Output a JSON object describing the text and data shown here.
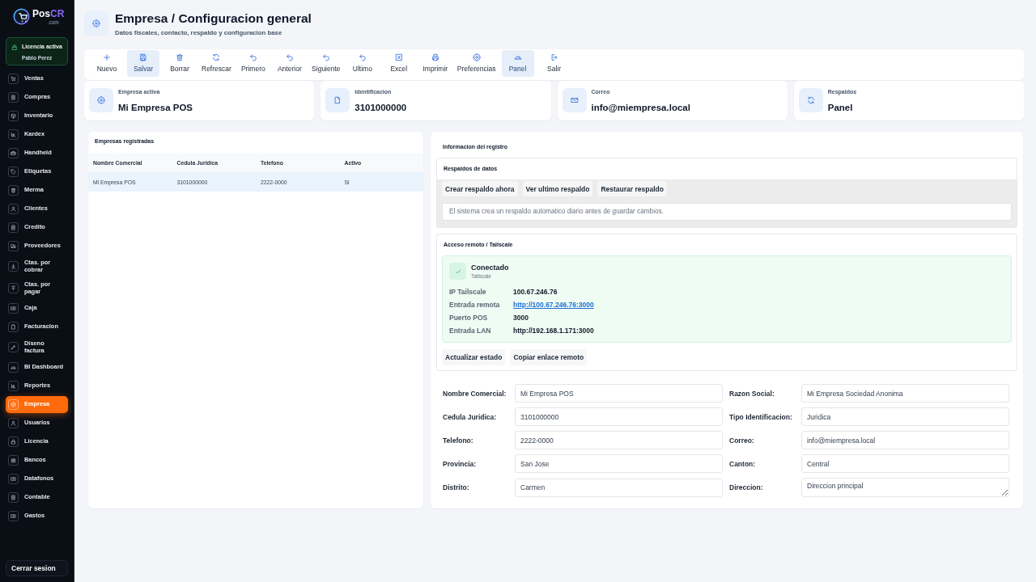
{
  "sidebar": {
    "logo": {
      "name": "Pos",
      "accent": "CR",
      "domain": ".com"
    },
    "license": {
      "title": "Licencia activa",
      "user": "Pablo Perez"
    },
    "items": [
      {
        "label": "Ventas",
        "selected": false
      },
      {
        "label": "Compras",
        "selected": false
      },
      {
        "label": "Inventario",
        "selected": false
      },
      {
        "label": "Kardex",
        "selected": false
      },
      {
        "label": "Handheld",
        "selected": false
      },
      {
        "label": "Etiquetas",
        "selected": false
      },
      {
        "label": "Merma",
        "selected": false
      },
      {
        "label": "Clientes",
        "selected": false
      },
      {
        "label": "Credito",
        "selected": false
      },
      {
        "label": "Proveedores",
        "selected": false
      },
      {
        "label": "Ctas. por cobrar",
        "selected": false
      },
      {
        "label": "Ctas. por pagar",
        "selected": false
      },
      {
        "label": "Caja",
        "selected": false
      },
      {
        "label": "Facturacion",
        "selected": false
      },
      {
        "label": "Diseno factura",
        "selected": false
      },
      {
        "label": "BI Dashboard",
        "selected": false
      },
      {
        "label": "Reportes",
        "selected": false
      },
      {
        "label": "Empresa",
        "selected": true
      },
      {
        "label": "Usuarios",
        "selected": false
      },
      {
        "label": "Licencia",
        "selected": false
      },
      {
        "label": "Bancos",
        "selected": false
      },
      {
        "label": "Datafonos",
        "selected": false
      },
      {
        "label": "Contable",
        "selected": false
      },
      {
        "label": "Gastos",
        "selected": false
      }
    ],
    "logout": "Cerrar sesion"
  },
  "header": {
    "title": "Empresa / Configuracion general",
    "subtitle": "Datos fiscales, contacto, respaldo y configuracion base"
  },
  "toolbar": [
    {
      "label": "Nuevo",
      "selected": false
    },
    {
      "label": "Salvar",
      "selected": true
    },
    {
      "label": "Borrar",
      "selected": false
    },
    {
      "label": "Refrescar",
      "selected": false
    },
    {
      "label": "Primero",
      "selected": false
    },
    {
      "label": "Anterior",
      "selected": false
    },
    {
      "label": "Siguiente",
      "selected": false
    },
    {
      "label": "Ultimo",
      "selected": false
    },
    {
      "label": "Excel",
      "selected": false
    },
    {
      "label": "Imprimir",
      "selected": false
    },
    {
      "label": "Preferencias",
      "selected": false
    },
    {
      "label": "Panel",
      "selected": true
    },
    {
      "label": "Salir",
      "selected": false
    }
  ],
  "stats": [
    {
      "label": "Empresa activa",
      "value": "Mi Empresa POS"
    },
    {
      "label": "Identificacion",
      "value": "3101000000"
    },
    {
      "label": "Correo",
      "value": "info@miempresa.local"
    },
    {
      "label": "Respaldos",
      "value": "Panel"
    }
  ],
  "companies": {
    "title": "Empresas registradas",
    "columns": [
      "Nombre Comercial",
      "Cedula Juridica",
      "Telefono",
      "Activo"
    ],
    "rows": [
      {
        "cells": [
          "Mi Empresa POS",
          "3101000000",
          "2222-0000",
          "Si"
        ],
        "selected": true
      }
    ]
  },
  "record": {
    "title": "Informacion del registro",
    "backups": {
      "title": "Respaldos de datos",
      "buttons": [
        "Crear respaldo ahora",
        "Ver ultimo respaldo",
        "Restaurar respaldo"
      ],
      "note": "El sistema crea un respaldo automatico diario antes de guardar cambios."
    },
    "remote": {
      "title": "Acceso remoto / Tailscale",
      "status": {
        "title": "Conectado",
        "subtitle": "Tailscale",
        "connected": true
      },
      "details": [
        {
          "label": "IP Tailscale",
          "value": "100.67.246.76",
          "kind": "text"
        },
        {
          "label": "Entrada remota",
          "value": "http://100.67.246.76:3000",
          "kind": "link"
        },
        {
          "label": "Puerto POS",
          "value": "3000",
          "kind": "text"
        },
        {
          "label": "Entrada LAN",
          "value": "http://192.168.1.171:3000",
          "kind": "text"
        }
      ],
      "buttons": [
        "Actualizar estado",
        "Copiar enlace remoto"
      ]
    },
    "form": [
      {
        "label": "Nombre Comercial:",
        "value": "Mi Empresa POS",
        "kind": "input"
      },
      {
        "label": "Razon Social:",
        "value": "Mi Empresa Sociedad Anonima",
        "kind": "input"
      },
      {
        "label": "Cedula Juridica:",
        "value": "3101000000",
        "kind": "input"
      },
      {
        "label": "Tipo Identificacion:",
        "value": "Juridica",
        "kind": "input"
      },
      {
        "label": "Telefono:",
        "value": "2222-0000",
        "kind": "input"
      },
      {
        "label": "Correo:",
        "value": "info@miempresa.local",
        "kind": "input"
      },
      {
        "label": "Provincia:",
        "value": "San Jose",
        "kind": "input"
      },
      {
        "label": "Canton:",
        "value": "Central",
        "kind": "input"
      },
      {
        "label": "Distrito:",
        "value": "Carmen",
        "kind": "input"
      },
      {
        "label": "Direccion:",
        "value": "Direccion principal",
        "kind": "textarea"
      }
    ]
  }
}
